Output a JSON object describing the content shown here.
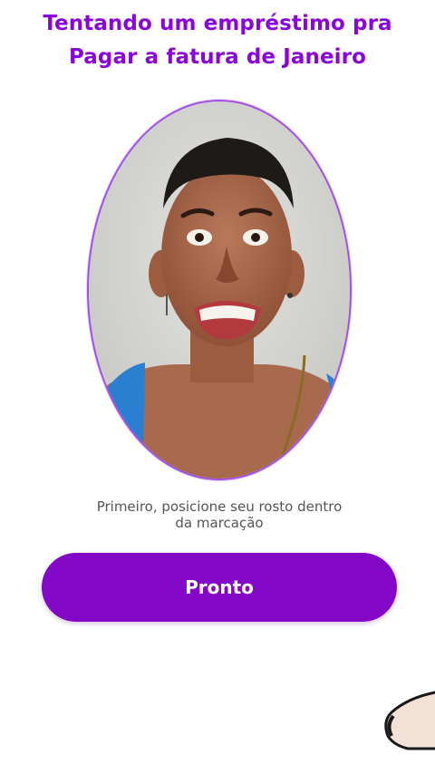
{
  "caption": {
    "line1": "Tentando um empréstimo pra",
    "line2": "Pagar a fatura de Janeiro",
    "color": "#8a05d9"
  },
  "face_capture": {
    "frame_color": "#a24fe6"
  },
  "instruction": {
    "line1": "Primeiro, posicione seu rosto dentro",
    "line2": "da marcação"
  },
  "action": {
    "label": "Pronto",
    "color": "#8207c7"
  }
}
